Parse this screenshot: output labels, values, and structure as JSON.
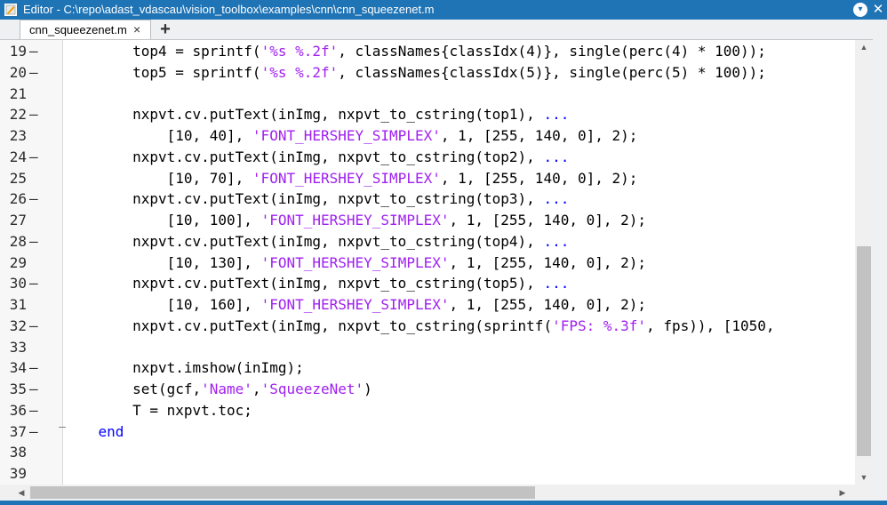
{
  "window": {
    "title": "Editor - C:\\repo\\adast_vdascau\\vision_toolbox\\examples\\cnn\\cnn_squeezenet.m",
    "menu_glyph": "▾",
    "close_glyph": "✕"
  },
  "tabs": [
    {
      "label": "cnn_squeezenet.m",
      "close_glyph": "×"
    }
  ],
  "new_tab_glyph": "+",
  "colors": {
    "keyword": "#0000ff",
    "string": "#a020f0",
    "continuation": "#0000ff",
    "titlebar": "#1f74b6"
  },
  "scroll_glyphs": {
    "up": "▲",
    "down": "▼",
    "left": "◀",
    "right": "▶"
  },
  "lines": [
    {
      "num": "19",
      "dash": "—",
      "segments": [
        {
          "t": "        top4 = sprintf(",
          "c": "n"
        },
        {
          "t": "'%s %.2f'",
          "c": "s"
        },
        {
          "t": ", classNames{classIdx(4)}, single(perc(4) * 100));",
          "c": "n"
        }
      ]
    },
    {
      "num": "20",
      "dash": "—",
      "segments": [
        {
          "t": "        top5 = sprintf(",
          "c": "n"
        },
        {
          "t": "'%s %.2f'",
          "c": "s"
        },
        {
          "t": ", classNames{classIdx(5)}, single(perc(5) * 100));",
          "c": "n"
        }
      ]
    },
    {
      "num": "21",
      "dash": "",
      "segments": []
    },
    {
      "num": "22",
      "dash": "—",
      "segments": [
        {
          "t": "        nxpvt.cv.putText(inImg, nxpvt_to_cstring(top1), ",
          "c": "n"
        },
        {
          "t": "...",
          "c": "k"
        }
      ]
    },
    {
      "num": "23",
      "dash": "",
      "segments": [
        {
          "t": "            [10, 40], ",
          "c": "n"
        },
        {
          "t": "'FONT_HERSHEY_SIMPLEX'",
          "c": "s"
        },
        {
          "t": ", 1, [255, 140, 0], 2);",
          "c": "n"
        }
      ]
    },
    {
      "num": "24",
      "dash": "—",
      "segments": [
        {
          "t": "        nxpvt.cv.putText(inImg, nxpvt_to_cstring(top2), ",
          "c": "n"
        },
        {
          "t": "...",
          "c": "k"
        }
      ]
    },
    {
      "num": "25",
      "dash": "",
      "segments": [
        {
          "t": "            [10, 70], ",
          "c": "n"
        },
        {
          "t": "'FONT_HERSHEY_SIMPLEX'",
          "c": "s"
        },
        {
          "t": ", 1, [255, 140, 0], 2);",
          "c": "n"
        }
      ]
    },
    {
      "num": "26",
      "dash": "—",
      "segments": [
        {
          "t": "        nxpvt.cv.putText(inImg, nxpvt_to_cstring(top3), ",
          "c": "n"
        },
        {
          "t": "...",
          "c": "k"
        }
      ]
    },
    {
      "num": "27",
      "dash": "",
      "segments": [
        {
          "t": "            [10, 100], ",
          "c": "n"
        },
        {
          "t": "'FONT_HERSHEY_SIMPLEX'",
          "c": "s"
        },
        {
          "t": ", 1, [255, 140, 0], 2);",
          "c": "n"
        }
      ]
    },
    {
      "num": "28",
      "dash": "—",
      "segments": [
        {
          "t": "        nxpvt.cv.putText(inImg, nxpvt_to_cstring(top4), ",
          "c": "n"
        },
        {
          "t": "...",
          "c": "k"
        }
      ]
    },
    {
      "num": "29",
      "dash": "",
      "segments": [
        {
          "t": "            [10, 130], ",
          "c": "n"
        },
        {
          "t": "'FONT_HERSHEY_SIMPLEX'",
          "c": "s"
        },
        {
          "t": ", 1, [255, 140, 0], 2);",
          "c": "n"
        }
      ]
    },
    {
      "num": "30",
      "dash": "—",
      "segments": [
        {
          "t": "        nxpvt.cv.putText(inImg, nxpvt_to_cstring(top5), ",
          "c": "n"
        },
        {
          "t": "...",
          "c": "k"
        }
      ]
    },
    {
      "num": "31",
      "dash": "",
      "segments": [
        {
          "t": "            [10, 160], ",
          "c": "n"
        },
        {
          "t": "'FONT_HERSHEY_SIMPLEX'",
          "c": "s"
        },
        {
          "t": ", 1, [255, 140, 0], 2);",
          "c": "n"
        }
      ]
    },
    {
      "num": "32",
      "dash": "—",
      "segments": [
        {
          "t": "        nxpvt.cv.putText(inImg, nxpvt_to_cstring(sprintf(",
          "c": "n"
        },
        {
          "t": "'FPS: %.3f'",
          "c": "s"
        },
        {
          "t": ", fps)), [1050,",
          "c": "n"
        }
      ]
    },
    {
      "num": "33",
      "dash": "",
      "segments": []
    },
    {
      "num": "34",
      "dash": "—",
      "segments": [
        {
          "t": "        nxpvt.imshow(inImg);",
          "c": "n"
        }
      ]
    },
    {
      "num": "35",
      "dash": "—",
      "segments": [
        {
          "t": "        set(gcf,",
          "c": "n"
        },
        {
          "t": "'Name'",
          "c": "s"
        },
        {
          "t": ",",
          "c": "n"
        },
        {
          "t": "'SqueezeNet'",
          "c": "s"
        },
        {
          "t": ")",
          "c": "n"
        }
      ]
    },
    {
      "num": "36",
      "dash": "—",
      "segments": [
        {
          "t": "        T = nxpvt.toc;",
          "c": "n"
        }
      ]
    },
    {
      "num": "37",
      "dash": "—",
      "segments": [
        {
          "t": "    ",
          "c": "n"
        },
        {
          "t": "end",
          "c": "k"
        }
      ]
    },
    {
      "num": "38",
      "dash": "",
      "segments": []
    },
    {
      "num": "39",
      "dash": "",
      "segments": []
    }
  ]
}
